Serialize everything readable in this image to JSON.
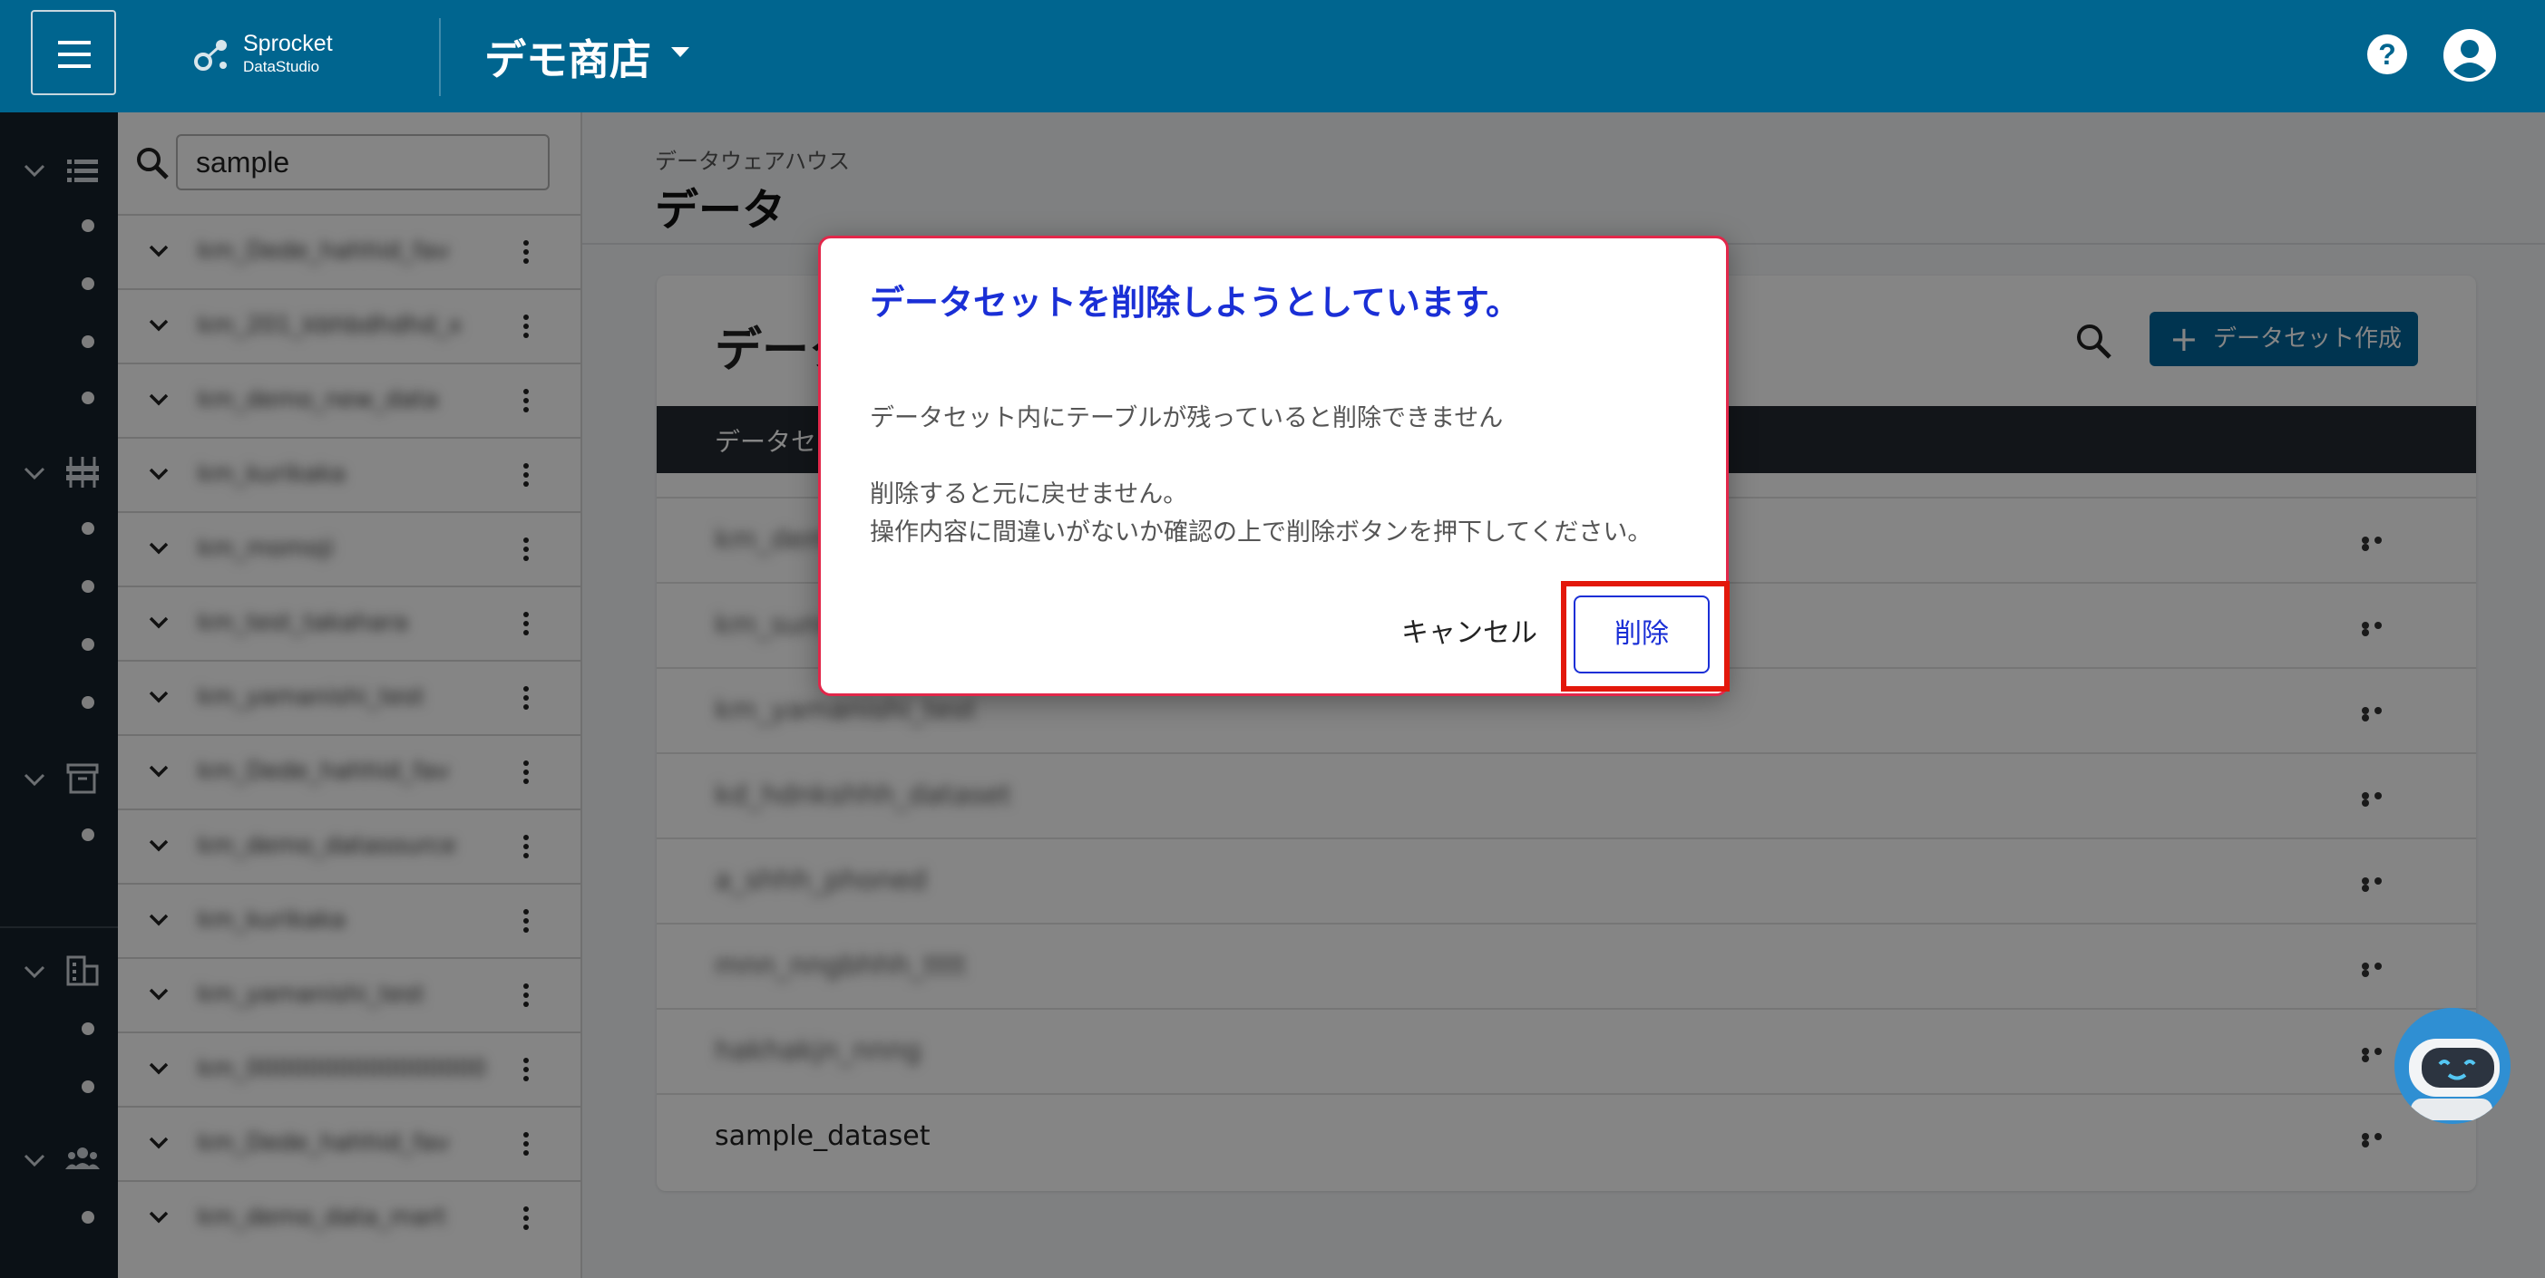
{
  "header": {
    "logo_name": "Sprocket",
    "logo_sub": "DataStudio",
    "store_name": "デモ商店",
    "help_symbol": "?"
  },
  "list_panel": {
    "search_value": "sample",
    "rows": [
      "km_Dede_hahhid_fav",
      "km_201_kbhbdhdhd_x",
      "km_demo_new_data",
      "km_kurikaka",
      "km_momoji",
      "km_test_takahara",
      "km_yamanishi_test",
      "km_Dede_hahhid_fav",
      "km_demo_datasource",
      "km_kurikaka",
      "km_yamanishi_test",
      "km_0000000000000000",
      "km_Dede_hahhid_fav",
      "km_demo_data_mart"
    ]
  },
  "main": {
    "breadcrumb": "データウェアハウス",
    "title": "データ",
    "card_title": "データ",
    "create_button": "データセット作成",
    "create_plus": "+",
    "column_header": "データセ",
    "rows": [
      {
        "name": "km_demo_new",
        "blurred": true
      },
      {
        "name": "km_sunmaka",
        "blurred": true
      },
      {
        "name": "km_yamanishi_test",
        "blurred": true
      },
      {
        "name": "kd_hdnkshhh_dataset",
        "blurred": true
      },
      {
        "name": "a_shhh_phoned",
        "blurred": true
      },
      {
        "name": "mnn_nngbhhh_tttt",
        "blurred": true
      },
      {
        "name": "hakhakjn_nnng",
        "blurred": true
      },
      {
        "name": "sample_dataset",
        "blurred": false
      }
    ]
  },
  "dialog": {
    "title": "データセットを削除しようとしています。",
    "line1": "データセット内にテーブルが残っていると削除できません",
    "line2": "削除すると元に戻せません。",
    "line3": "操作内容に間違いがないか確認の上で削除ボタンを押下してください。",
    "cancel": "キャンセル",
    "delete": "削除"
  },
  "colors": {
    "header": "#00658f",
    "rail": "#16212b",
    "accent": "#00659a",
    "dialog_title": "#1a2fd6",
    "dialog_border": "#e2274a",
    "highlight": "#e3180b"
  }
}
